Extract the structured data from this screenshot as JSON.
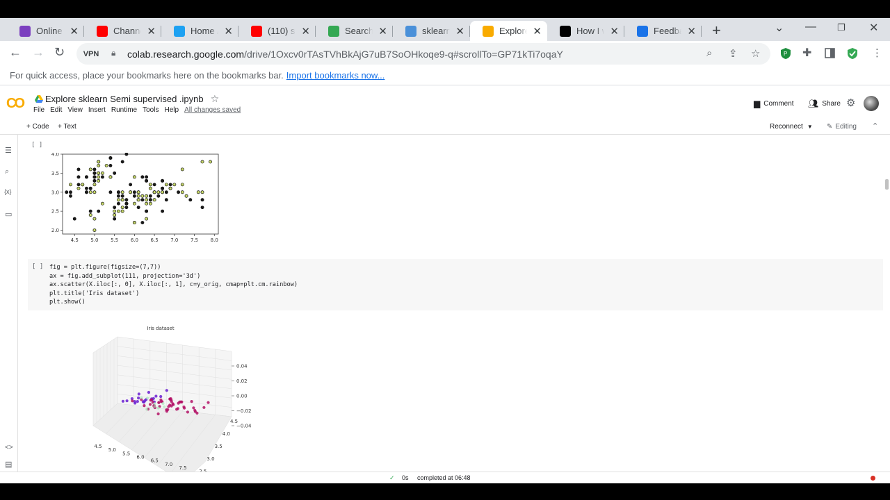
{
  "browser": {
    "tabs": [
      {
        "label": "Online Co...",
        "icon": "course-icon",
        "color": "#7b3fbf"
      },
      {
        "label": "Channel...",
        "icon": "youtube-icon",
        "color": "#ff0000"
      },
      {
        "label": "Home / T...",
        "icon": "twitter-icon",
        "color": "#1da1f2"
      },
      {
        "label": "(110) ser...",
        "icon": "youtube-icon",
        "color": "#ff0000"
      },
      {
        "label": "Search re...",
        "icon": "drive-icon",
        "color": "#34a853"
      },
      {
        "label": "sklearn.s...",
        "icon": "bar-chart-icon",
        "color": "#4a90d9"
      },
      {
        "label": "Explore s...",
        "icon": "colab-icon",
        "color": "#f9ab00"
      },
      {
        "label": "How I w...",
        "icon": "medium-icon",
        "color": "#000000"
      },
      {
        "label": "Feedback...",
        "icon": "k-icon",
        "color": "#1a73e8"
      }
    ],
    "active_tab_index": 6,
    "vpn_label": "VPN",
    "url_host": "colab.research.google.com",
    "url_path": "/drive/1Oxcv0rTAsTVhBkAjG7uB7SoOHkoqe9-q#scrollTo=GP71kTi7oqaY",
    "bookmarks_text": "For quick access, place your bookmarks here on the bookmarks bar.",
    "bookmarks_link": "Import bookmarks now..."
  },
  "colab": {
    "logo": "CO",
    "title": "Explore sklearn Semi supervised .ipynb",
    "menus": [
      "File",
      "Edit",
      "View",
      "Insert",
      "Runtime",
      "Tools",
      "Help"
    ],
    "saved_status": "All changes saved",
    "comment_label": "Comment",
    "share_label": "Share",
    "add_code": "+ Code",
    "add_text": "+ Text",
    "reconnect": "Reconnect",
    "editing": "Editing"
  },
  "cells": {
    "run_indicator": "[ ]",
    "code_lines": [
      "fig = plt.figure(figsize=(7,7))",
      "ax = fig.add_subplot(111, projection='3d')",
      "ax.scatter(X.iloc[:, 0], X.iloc[:, 1], c=y_orig, cmap=plt.cm.rainbow)",
      "plt.title('Iris dataset')",
      "plt.show()"
    ]
  },
  "chart_data": [
    {
      "type": "scatter",
      "title": "",
      "xlabel": "",
      "ylabel": "",
      "xlim": [
        4.2,
        8.1
      ],
      "ylim": [
        1.9,
        4.0
      ],
      "xticks": [
        "4.5",
        "5.0",
        "5.5",
        "6.0",
        "6.5",
        "7.0",
        "7.5",
        "8.0"
      ],
      "yticks": [
        "2.0",
        "2.5",
        "3.0",
        "3.5",
        "4.0"
      ],
      "points": [
        [
          5.1,
          3.5,
          0
        ],
        [
          4.9,
          3.0,
          1
        ],
        [
          4.7,
          3.2,
          0
        ],
        [
          4.6,
          3.1,
          1
        ],
        [
          5.0,
          3.6,
          0
        ],
        [
          5.4,
          3.9,
          1
        ],
        [
          4.6,
          3.4,
          0
        ],
        [
          5.0,
          3.4,
          1
        ],
        [
          4.4,
          2.9,
          0
        ],
        [
          4.9,
          3.1,
          1
        ],
        [
          5.4,
          3.7,
          0
        ],
        [
          4.8,
          3.4,
          1
        ],
        [
          4.8,
          3.0,
          0
        ],
        [
          4.3,
          3.0,
          0
        ],
        [
          5.8,
          4.0,
          0
        ],
        [
          5.7,
          4.4,
          1
        ],
        [
          5.4,
          3.9,
          0
        ],
        [
          5.1,
          3.5,
          1
        ],
        [
          5.7,
          3.8,
          0
        ],
        [
          5.1,
          3.8,
          1
        ],
        [
          5.4,
          3.4,
          0
        ],
        [
          5.1,
          3.7,
          1
        ],
        [
          4.6,
          3.6,
          0
        ],
        [
          5.1,
          3.3,
          1
        ],
        [
          4.8,
          3.4,
          0
        ],
        [
          5.0,
          3.0,
          1
        ],
        [
          5.0,
          3.4,
          0
        ],
        [
          5.2,
          3.5,
          1
        ],
        [
          5.2,
          3.4,
          0
        ],
        [
          4.7,
          3.2,
          1
        ],
        [
          4.8,
          3.1,
          0
        ],
        [
          5.4,
          3.4,
          1
        ],
        [
          5.2,
          4.1,
          0
        ],
        [
          5.5,
          4.2,
          1
        ],
        [
          4.9,
          3.1,
          0
        ],
        [
          5.0,
          3.2,
          1
        ],
        [
          5.5,
          3.5,
          0
        ],
        [
          4.9,
          3.6,
          1
        ],
        [
          4.4,
          3.0,
          0
        ],
        [
          5.1,
          3.4,
          1
        ],
        [
          5.0,
          3.5,
          0
        ],
        [
          4.5,
          2.3,
          0
        ],
        [
          4.4,
          3.2,
          1
        ],
        [
          5.0,
          3.5,
          0
        ],
        [
          5.1,
          3.8,
          1
        ],
        [
          4.8,
          3.0,
          0
        ],
        [
          5.1,
          3.8,
          1
        ],
        [
          4.6,
          3.2,
          0
        ],
        [
          5.3,
          3.7,
          1
        ],
        [
          5.0,
          3.3,
          0
        ],
        [
          7.0,
          3.2,
          1
        ],
        [
          6.4,
          3.2,
          0
        ],
        [
          6.9,
          3.1,
          1
        ],
        [
          5.5,
          2.3,
          0
        ],
        [
          6.5,
          2.8,
          1
        ],
        [
          5.7,
          2.8,
          0
        ],
        [
          6.3,
          3.3,
          1
        ],
        [
          4.9,
          2.4,
          1
        ],
        [
          6.6,
          2.9,
          0
        ],
        [
          5.2,
          2.7,
          1
        ],
        [
          5.0,
          2.0,
          1
        ],
        [
          5.9,
          3.0,
          0
        ],
        [
          6.0,
          2.2,
          0
        ],
        [
          6.1,
          2.9,
          1
        ],
        [
          5.6,
          2.9,
          0
        ],
        [
          6.7,
          3.1,
          1
        ],
        [
          5.6,
          3.0,
          0
        ],
        [
          5.8,
          2.7,
          1
        ],
        [
          6.2,
          2.2,
          0
        ],
        [
          5.6,
          2.5,
          1
        ],
        [
          5.9,
          3.2,
          0
        ],
        [
          6.1,
          2.8,
          1
        ],
        [
          6.3,
          2.5,
          0
        ],
        [
          6.1,
          2.8,
          1
        ],
        [
          6.4,
          2.9,
          0
        ],
        [
          6.6,
          3.0,
          1
        ],
        [
          6.8,
          2.8,
          0
        ],
        [
          6.7,
          3.0,
          1
        ],
        [
          6.0,
          2.9,
          0
        ],
        [
          5.7,
          2.6,
          1
        ],
        [
          5.5,
          2.4,
          0
        ],
        [
          5.5,
          2.4,
          1
        ],
        [
          5.8,
          2.7,
          0
        ],
        [
          6.0,
          2.7,
          1
        ],
        [
          5.4,
          3.0,
          0
        ],
        [
          6.0,
          3.4,
          1
        ],
        [
          6.7,
          3.1,
          0
        ],
        [
          6.3,
          2.3,
          1
        ],
        [
          5.6,
          3.0,
          0
        ],
        [
          5.5,
          2.5,
          1
        ],
        [
          5.5,
          2.6,
          0
        ],
        [
          6.1,
          3.0,
          1
        ],
        [
          5.8,
          2.6,
          0
        ],
        [
          5.0,
          2.3,
          1
        ],
        [
          5.6,
          2.7,
          0
        ],
        [
          5.7,
          3.0,
          1
        ],
        [
          5.7,
          2.9,
          0
        ],
        [
          6.2,
          2.9,
          1
        ],
        [
          5.1,
          2.5,
          0
        ],
        [
          5.7,
          2.8,
          1
        ],
        [
          6.3,
          3.3,
          0
        ],
        [
          5.8,
          2.7,
          1
        ],
        [
          7.1,
          3.0,
          0
        ],
        [
          6.3,
          2.9,
          1
        ],
        [
          6.5,
          3.0,
          0
        ],
        [
          7.6,
          3.0,
          1
        ],
        [
          4.9,
          2.5,
          0
        ],
        [
          7.3,
          2.9,
          1
        ],
        [
          6.7,
          2.5,
          0
        ],
        [
          7.2,
          3.6,
          1
        ],
        [
          6.5,
          3.2,
          0
        ],
        [
          6.4,
          2.7,
          1
        ],
        [
          6.8,
          3.0,
          0
        ],
        [
          5.7,
          2.5,
          1
        ],
        [
          5.8,
          2.8,
          0
        ],
        [
          6.4,
          3.2,
          1
        ],
        [
          6.5,
          3.0,
          0
        ],
        [
          7.7,
          3.8,
          1
        ],
        [
          7.7,
          2.6,
          0
        ],
        [
          6.0,
          2.2,
          1
        ],
        [
          6.9,
          3.2,
          0
        ],
        [
          5.6,
          2.8,
          1
        ],
        [
          7.7,
          2.8,
          0
        ],
        [
          6.3,
          2.7,
          1
        ],
        [
          6.7,
          3.3,
          0
        ],
        [
          7.2,
          3.2,
          1
        ],
        [
          6.2,
          2.8,
          0
        ],
        [
          6.1,
          3.0,
          1
        ],
        [
          6.4,
          2.8,
          0
        ],
        [
          7.2,
          3.0,
          1
        ],
        [
          7.4,
          2.8,
          0
        ],
        [
          7.9,
          3.8,
          1
        ],
        [
          6.4,
          2.8,
          0
        ],
        [
          6.3,
          2.8,
          1
        ],
        [
          6.1,
          2.6,
          0
        ],
        [
          7.7,
          3.0,
          1
        ],
        [
          6.3,
          3.4,
          0
        ],
        [
          6.4,
          3.1,
          1
        ],
        [
          6.0,
          3.0,
          0
        ],
        [
          6.9,
          3.1,
          1
        ],
        [
          6.7,
          3.1,
          0
        ],
        [
          6.9,
          3.1,
          1
        ],
        [
          5.8,
          2.7,
          0
        ],
        [
          6.8,
          3.2,
          1
        ],
        [
          6.7,
          3.3,
          0
        ],
        [
          6.7,
          3.0,
          1
        ],
        [
          6.3,
          2.5,
          0
        ],
        [
          6.5,
          3.0,
          1
        ],
        [
          6.2,
          3.4,
          0
        ],
        [
          5.9,
          3.0,
          1
        ]
      ],
      "point_colors": [
        "#1a1a1a",
        "#c8d96a"
      ]
    },
    {
      "type": "scatter",
      "title": "Iris dataset",
      "xlabel": "",
      "ylabel": "",
      "xticks": [
        "4.5",
        "5.0",
        "5.5",
        "6.0",
        "6.5",
        "7.0",
        "7.5"
      ],
      "yticks": [
        "2.0",
        "2.5",
        "3.0",
        "3.5",
        "4.0",
        "4.5"
      ],
      "zticks": [
        "0.04",
        "0.02",
        "0.00",
        "−0.02",
        "−0.04"
      ],
      "points": [
        [
          5.1,
          3.5,
          0
        ],
        [
          4.9,
          3.0,
          0
        ],
        [
          4.7,
          3.2,
          0
        ],
        [
          5.0,
          3.6,
          0
        ],
        [
          5.4,
          3.9,
          0
        ],
        [
          4.6,
          3.4,
          0
        ],
        [
          5.0,
          3.4,
          0
        ],
        [
          4.9,
          3.1,
          0
        ],
        [
          5.4,
          3.7,
          0
        ],
        [
          4.8,
          3.4,
          0
        ],
        [
          5.7,
          4.4,
          0
        ],
        [
          5.1,
          3.8,
          0
        ],
        [
          5.4,
          3.4,
          0
        ],
        [
          5.2,
          4.1,
          0
        ],
        [
          5.5,
          4.2,
          0
        ],
        [
          4.4,
          3.0,
          0
        ],
        [
          5.0,
          3.5,
          0
        ],
        [
          4.5,
          2.3,
          0
        ],
        [
          5.3,
          3.7,
          0
        ],
        [
          4.6,
          3.1,
          0
        ],
        [
          7.0,
          3.2,
          1
        ],
        [
          6.4,
          3.2,
          1
        ],
        [
          6.9,
          3.1,
          1
        ],
        [
          5.5,
          2.3,
          1
        ],
        [
          6.5,
          2.8,
          1
        ],
        [
          5.7,
          2.8,
          1
        ],
        [
          6.3,
          3.3,
          1
        ],
        [
          4.9,
          2.4,
          1
        ],
        [
          6.6,
          2.9,
          1
        ],
        [
          5.2,
          2.7,
          1
        ],
        [
          5.9,
          3.0,
          1
        ],
        [
          6.0,
          2.2,
          1
        ],
        [
          6.1,
          2.9,
          1
        ],
        [
          5.6,
          2.9,
          1
        ],
        [
          6.7,
          3.1,
          1
        ],
        [
          5.8,
          2.7,
          1
        ],
        [
          6.2,
          2.2,
          1
        ],
        [
          5.6,
          2.5,
          1
        ],
        [
          6.1,
          2.8,
          1
        ],
        [
          6.4,
          2.9,
          1
        ],
        [
          6.3,
          3.3,
          2
        ],
        [
          5.8,
          2.7,
          2
        ],
        [
          7.1,
          3.0,
          2
        ],
        [
          6.3,
          2.9,
          2
        ],
        [
          6.5,
          3.0,
          2
        ],
        [
          7.6,
          3.0,
          2
        ],
        [
          7.3,
          2.9,
          2
        ],
        [
          6.7,
          2.5,
          2
        ],
        [
          7.2,
          3.6,
          2
        ],
        [
          6.5,
          3.2,
          2
        ],
        [
          6.4,
          2.7,
          2
        ],
        [
          6.8,
          3.0,
          2
        ],
        [
          5.7,
          2.5,
          2
        ],
        [
          5.8,
          2.8,
          2
        ],
        [
          7.7,
          3.8,
          2
        ],
        [
          7.7,
          2.6,
          2
        ],
        [
          6.9,
          3.2,
          2
        ],
        [
          5.6,
          2.8,
          2
        ],
        [
          7.7,
          2.8,
          2
        ],
        [
          6.7,
          3.3,
          2
        ],
        [
          7.9,
          3.8,
          2
        ],
        [
          6.4,
          2.8,
          2
        ],
        [
          6.1,
          2.6,
          2
        ],
        [
          7.7,
          3.0,
          2
        ],
        [
          6.3,
          3.4,
          2
        ],
        [
          6.0,
          3.0,
          2
        ],
        [
          6.9,
          3.1,
          2
        ],
        [
          5.8,
          2.7,
          2
        ],
        [
          6.8,
          3.2,
          2
        ],
        [
          5.9,
          3.0,
          2
        ],
        [
          5.2,
          3.4,
          3
        ],
        [
          5.0,
          3.2,
          3
        ],
        [
          5.5,
          3.5,
          3
        ],
        [
          6.0,
          2.7,
          3
        ],
        [
          5.5,
          2.6,
          3
        ],
        [
          6.2,
          2.9,
          3
        ],
        [
          5.7,
          3.0,
          3
        ],
        [
          6.1,
          3.0,
          3
        ]
      ],
      "point_colors": [
        "#6a1fd1",
        "#b31266",
        "#b31266",
        "#9fe8b4"
      ]
    }
  ],
  "status": {
    "elapsed": "0s",
    "message": "completed at 06:48"
  }
}
